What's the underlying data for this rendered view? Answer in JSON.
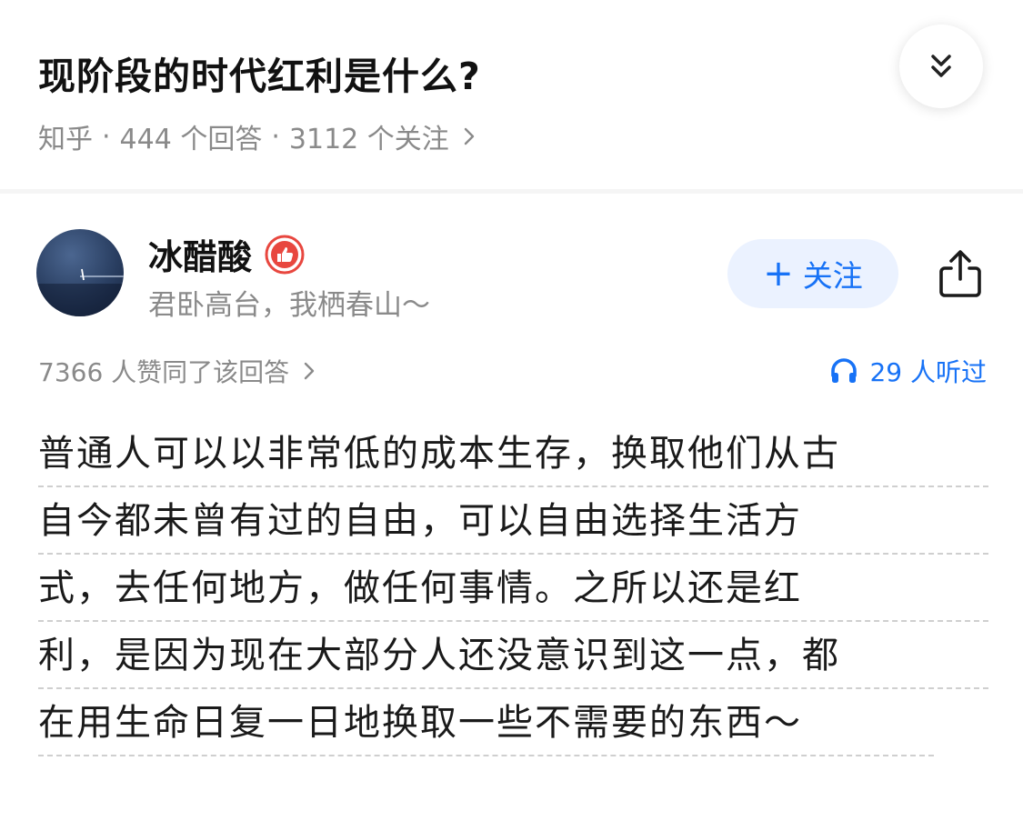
{
  "question": {
    "title": "现阶段的时代红利是什么?",
    "source": "知乎",
    "answers_count": "444 个回答",
    "followers_count": "3112 个关注"
  },
  "author": {
    "name": "冰醋酸",
    "bio": "君卧高台，我栖春山～",
    "follow_label": "关注",
    "follow_plus": "+"
  },
  "stats": {
    "likes_text": "7366 人赞同了该回答",
    "listened_text": "29 人听过"
  },
  "answer": {
    "lines": [
      "普通人可以以非常低的成本生存，换取他们从古",
      "自今都未曾有过的自由，可以自由选择生活方",
      "式，去任何地方，做任何事情。之所以还是红",
      "利，是因为现在大部分人还没意识到这一点，都",
      "在用生命日复一日地换取一些不需要的东西～"
    ]
  },
  "colors": {
    "accent": "#1772f6",
    "follow_bg": "#ebf2ff",
    "meta_gray": "#8a8a8a",
    "badge_red": "#e8473f"
  },
  "icons": {
    "collapse": "double-chevron-down-icon",
    "share": "share-icon",
    "headphones": "headphones-icon",
    "badge": "thumbs-up-badge-icon"
  }
}
